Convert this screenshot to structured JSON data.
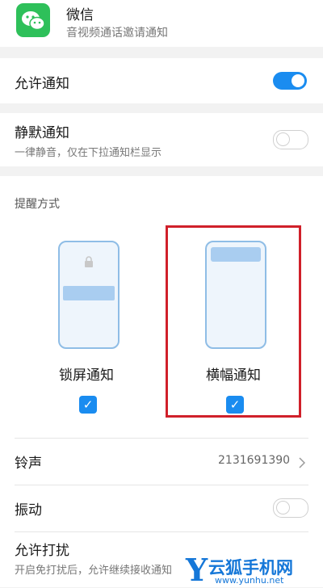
{
  "app": {
    "name": "微信",
    "subtitle": "音视频通话邀请通知",
    "icon": "wechat-icon"
  },
  "allow_notify": {
    "label": "允许通知",
    "on": true
  },
  "silent_notify": {
    "label": "静默通知",
    "desc": "一律静音，仅在下拉通知栏显示",
    "on": false
  },
  "remind": {
    "section_label": "提醒方式",
    "options": [
      {
        "label": "锁屏通知",
        "checked": true,
        "icon": "lock-icon"
      },
      {
        "label": "横幅通知",
        "checked": true,
        "highlighted": true
      }
    ]
  },
  "ringtone": {
    "label": "铃声",
    "value": "2131691390",
    "icon": "chevron-right-icon"
  },
  "vibrate": {
    "label": "振动",
    "on": false
  },
  "dnd": {
    "label": "允许打扰",
    "desc": "开启免打扰后，允许继续接收通知"
  },
  "watermark": {
    "text": "云狐手机网",
    "url": "www.yunhu.net"
  },
  "colors": {
    "accent": "#1a8cf0",
    "highlight_border": "#d0202a",
    "wechat_green": "#2ec05a"
  }
}
